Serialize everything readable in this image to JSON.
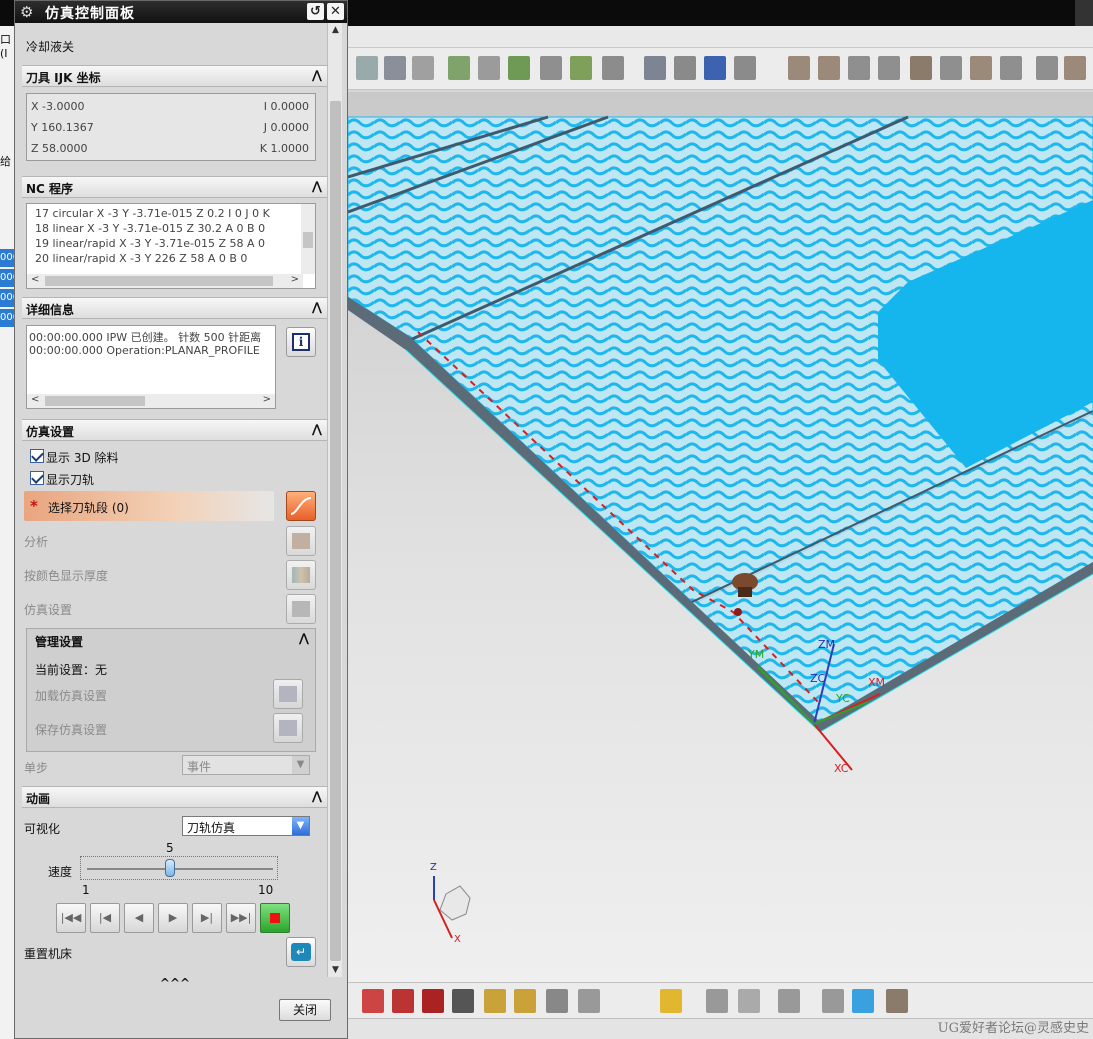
{
  "dialog": {
    "title": "仿真控制面板",
    "title_buttons": {
      "reset": "↺",
      "close": "✕"
    },
    "top_partial_text": "冷却液关",
    "sections": {
      "tool_ijk": {
        "header": "刀具 IJK 坐标",
        "x": "X -3.0000",
        "y": "Y 160.1367",
        "z": "Z 58.0000",
        "i": "I 0.0000",
        "j": "J 0.0000",
        "k": "K 1.0000"
      },
      "nc_program": {
        "header": "NC 程序",
        "lines": [
          "17 circular  X -3 Y -3.71e-015 Z 0.2 I 0 J 0 K",
          "18 linear X -3 Y -3.71e-015 Z 30.2 A 0 B 0",
          "19 linear/rapid X -3 Y -3.71e-015 Z 58 A 0",
          "20 linear/rapid X -3 Y 226 Z 58 A 0 B 0"
        ]
      },
      "details": {
        "header": "详细信息",
        "lines": [
          "00:00:00.000 IPW 已创建。 针数 500 针距离",
          "00:00:00.000 Operation:PLANAR_PROFILE"
        ],
        "info_icon": "i"
      },
      "sim_settings": {
        "header": "仿真设置",
        "show_3d_removal": "显示 3D 除料",
        "show_toolpath": "显示刀轨",
        "select_segment": "选择刀轨段 (0)",
        "analysis": "分析",
        "thickness_by_color": "按颜色显示厚度",
        "sim_settings_label": "仿真设置",
        "management": {
          "header": "管理设置",
          "current": "当前设置：无",
          "load": "加载仿真设置",
          "save": "保存仿真设置"
        },
        "single_step_label": "单步",
        "single_step_value": "事件"
      },
      "animation": {
        "header": "动画",
        "visualize_label": "可视化",
        "visualize_value": "刀轨仿真",
        "speed_label": "速度",
        "speed_value": "5",
        "speed_min": "1",
        "speed_max": "10",
        "reset_machine": "重置机床"
      }
    },
    "collapse_label": "^^^",
    "close_button": "关闭"
  },
  "viewport": {
    "axis_labels": [
      "ZM",
      "ZC",
      "YC",
      "XM",
      "YM",
      "XC"
    ],
    "triad": {
      "z": "Z",
      "x": "X"
    }
  },
  "left_edge": {
    "fragments": [
      "口(I",
      "给"
    ],
    "selected_rows": [
      "000",
      "000",
      "000",
      "000"
    ]
  },
  "watermark": "UG爱好者论坛@灵感史史",
  "colors": {
    "accent": "#1fb8ec",
    "selection_row": "#e9a57f",
    "title_bar": "#111111"
  }
}
